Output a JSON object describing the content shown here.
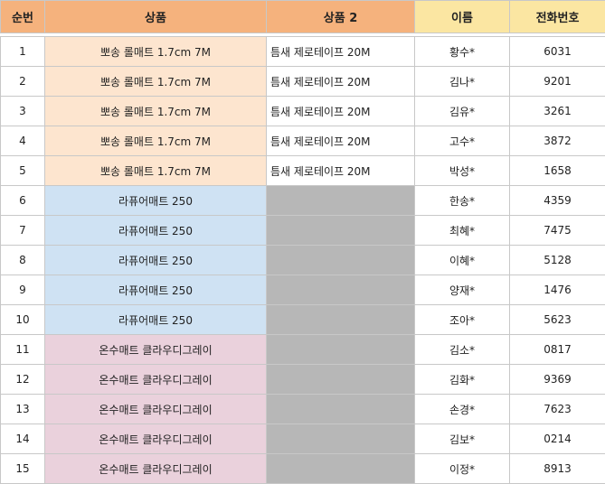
{
  "headers": [
    "순번",
    "상품",
    "상품 2",
    "이름",
    "전화번호"
  ],
  "rows": [
    {
      "no": "1",
      "product": "뽀송 롤매트 1.7cm 7M",
      "product2": "틈새 제로테이프 20M",
      "name": "황수*",
      "phone": "6031"
    },
    {
      "no": "2",
      "product": "뽀송 롤매트 1.7cm 7M",
      "product2": "틈새 제로테이프 20M",
      "name": "김나*",
      "phone": "9201"
    },
    {
      "no": "3",
      "product": "뽀송 롤매트 1.7cm 7M",
      "product2": "틈새 제로테이프 20M",
      "name": "김유*",
      "phone": "3261"
    },
    {
      "no": "4",
      "product": "뽀송 롤매트 1.7cm 7M",
      "product2": "틈새 제로테이프 20M",
      "name": "고수*",
      "phone": "3872"
    },
    {
      "no": "5",
      "product": "뽀송 롤매트 1.7cm 7M",
      "product2": "틈새 제로테이프 20M",
      "name": "박성*",
      "phone": "1658"
    },
    {
      "no": "6",
      "product": "라퓨어매트 250",
      "product2": "",
      "name": "한송*",
      "phone": "4359"
    },
    {
      "no": "7",
      "product": "라퓨어매트 250",
      "product2": "",
      "name": "최혜*",
      "phone": "7475"
    },
    {
      "no": "8",
      "product": "라퓨어매트 250",
      "product2": "",
      "name": "이혜*",
      "phone": "5128"
    },
    {
      "no": "9",
      "product": "라퓨어매트 250",
      "product2": "",
      "name": "양재*",
      "phone": "1476"
    },
    {
      "no": "10",
      "product": "라퓨어매트 250",
      "product2": "",
      "name": "조아*",
      "phone": "5623"
    },
    {
      "no": "11",
      "product": "온수매트 클라우디그레이",
      "product2": "",
      "name": "김소*",
      "phone": "0817"
    },
    {
      "no": "12",
      "product": "온수매트 클라우디그레이",
      "product2": "",
      "name": "김화*",
      "phone": "9369"
    },
    {
      "no": "13",
      "product": "온수매트 클라우디그레이",
      "product2": "",
      "name": "손경*",
      "phone": "7623"
    },
    {
      "no": "14",
      "product": "온수매트 클라우디그레이",
      "product2": "",
      "name": "김보*",
      "phone": "0214"
    },
    {
      "no": "15",
      "product": "온수매트 클라우디그레이",
      "product2": "",
      "name": "이정*",
      "phone": "8913"
    }
  ],
  "colors": {
    "header_orange": "#f5b27d",
    "header_yellow": "#fbe6a2",
    "peach": "#fde5cf",
    "blue": "#cfe2f3",
    "pink": "#ead1dc",
    "gray": "#b7b7b7"
  }
}
